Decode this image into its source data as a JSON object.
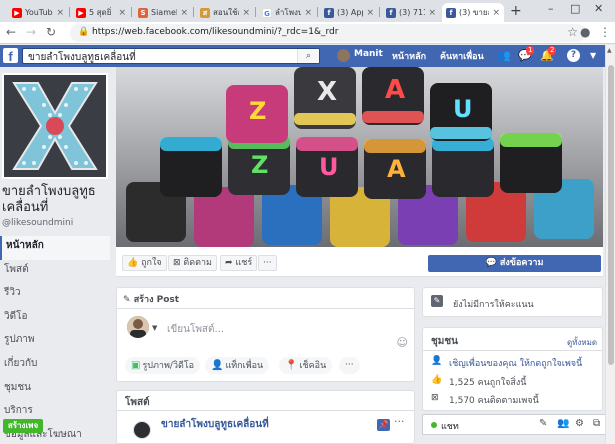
{
  "browser": {
    "tabs": [
      {
        "label": "YouTub",
        "icon": "youtube-icon",
        "color": "#ff0000"
      },
      {
        "label": "5 สุดยิ่",
        "icon": "youtube-icon",
        "color": "#ff0000"
      },
      {
        "label": "Siameli",
        "icon": "siam-icon",
        "color": "#e0633a"
      },
      {
        "label": "สอนใช้ส",
        "icon": "site-icon",
        "color": "#d49a3a"
      },
      {
        "label": "ลำโพงบ",
        "icon": "google-icon",
        "color": "#4285f4"
      },
      {
        "label": "(3) Appl",
        "icon": "facebook-icon",
        "color": "#3b5998"
      },
      {
        "label": "(3) 711",
        "icon": "facebook-icon",
        "color": "#3b5998"
      },
      {
        "label": "(3) ขายล",
        "icon": "facebook-icon",
        "color": "#3b5998"
      }
    ],
    "new_tab": "+",
    "url": "https://web.facebook.com/likesoundmini/?_rdc=1&_rdr"
  },
  "fb": {
    "search_value": "ขายลำโพงบลูทูธเคลื่อนที่",
    "user_name": "Manit",
    "nav_home": "หน้าหลัก",
    "nav_find_friends": "ค้นหาเพื่อน",
    "badge_messages": "1",
    "badge_notifications": "2",
    "help": "?"
  },
  "page": {
    "name": "ขายลำโพงบลูทูธเคลื่อนที่",
    "handle": "@likesoundmini",
    "nav": [
      "หน้าหลัก",
      "โพสต์",
      "รีวิว",
      "วิดีโอ",
      "รูปภาพ",
      "เกี่ยวกับ",
      "ชุมชน",
      "บริการ",
      "ข้อมูลและโฆษณา"
    ],
    "create_page_button": "สร้างเพจ"
  },
  "cover_letters": [
    "X",
    "A",
    "Z",
    "U",
    "Z",
    "U",
    "A"
  ],
  "actions": {
    "like": "ถูกใจ",
    "follow": "ติดตาม",
    "share": "แชร์",
    "more": "···",
    "send_message": "ส่งข้อความ"
  },
  "create_post": {
    "title": "สร้าง Post",
    "placeholder": "เขียนโพสต์...",
    "photo_video": "รูปภาพ/วิดีโอ",
    "tag_friends": "แท็กเพื่อน",
    "check_in": "เช็คอิน",
    "more": "···"
  },
  "posts": {
    "header": "โพสต์",
    "author": "ขายลำโพงบลูทูธเคลื่อนที่",
    "more": "···"
  },
  "right": {
    "rating_text": "ยังไม่มีการให้คะแนน",
    "community_header": "ชุมชน",
    "see_all": "ดูทั้งหมด",
    "invite_text": "เชิญเพื่อนของคุณ ให้กดถูกใจเพจนี้",
    "likes_text": "1,525 คนถูกใจสิ่งนี้",
    "follows_text": "1,570 คนติดตามเพจนี้"
  },
  "chat": {
    "label": "แชท"
  }
}
